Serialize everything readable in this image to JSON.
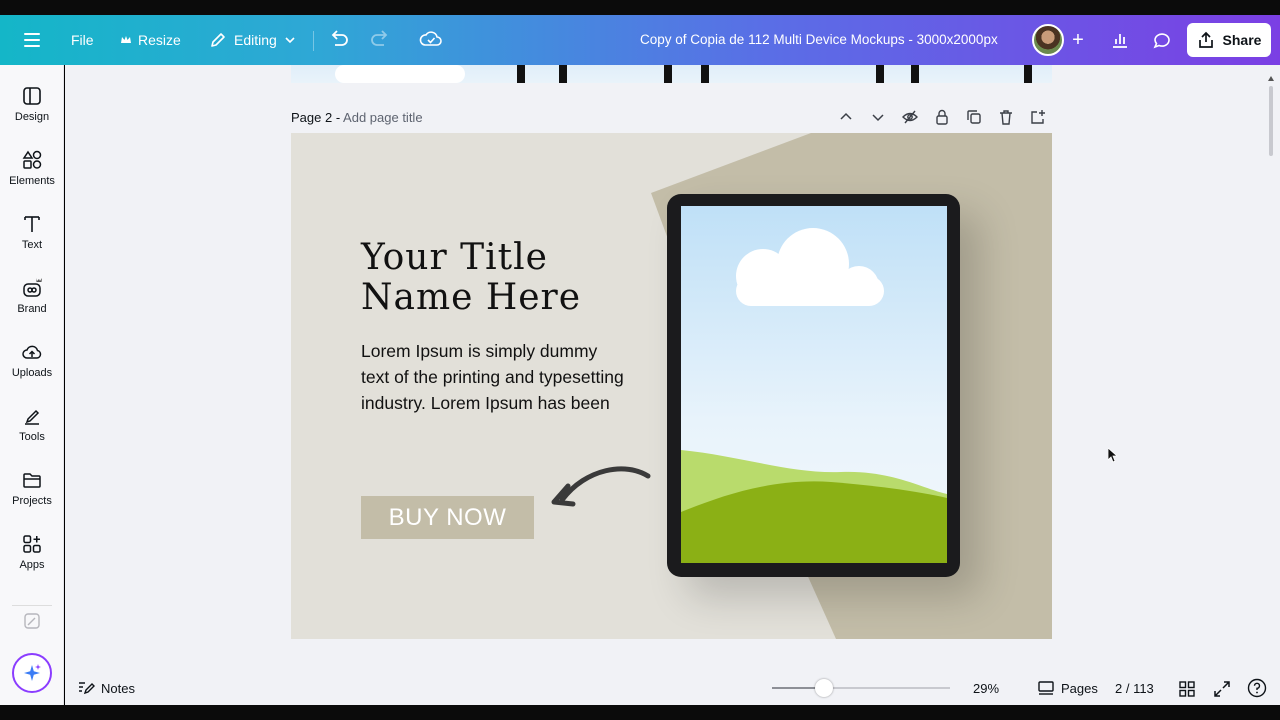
{
  "header": {
    "file_label": "File",
    "resize_label": "Resize",
    "editing_label": "Editing",
    "doc_title": "Copy of Copia de 112  Multi Device Mockups - 3000x2000px",
    "share_label": "Share",
    "gradient_start": "#14b6c8",
    "gradient_end": "#7b3fe4"
  },
  "sidebar": {
    "items": [
      {
        "label": "Design",
        "icon": "design-icon"
      },
      {
        "label": "Elements",
        "icon": "elements-icon"
      },
      {
        "label": "Text",
        "icon": "text-icon"
      },
      {
        "label": "Brand",
        "icon": "brand-icon"
      },
      {
        "label": "Uploads",
        "icon": "uploads-icon"
      },
      {
        "label": "Tools",
        "icon": "tools-icon"
      },
      {
        "label": "Projects",
        "icon": "projects-icon"
      },
      {
        "label": "Apps",
        "icon": "apps-icon"
      }
    ]
  },
  "page": {
    "label": "Page 2 - ",
    "title_placeholder": "Add page title",
    "design_title_line1": "Your Title",
    "design_title_line2": "Name Here",
    "body_text": "Lorem Ipsum is simply dummy text of the printing and typesetting industry. Lorem Ipsum has been",
    "button_label": "BUY NOW",
    "background_color": "#e2e0d9",
    "button_color": "#c3bda8"
  },
  "bottom_bar": {
    "notes_label": "Notes",
    "zoom_level": "29%",
    "zoom_fraction": 0.29,
    "pages_label": "Pages",
    "page_count": "2 / 113"
  }
}
